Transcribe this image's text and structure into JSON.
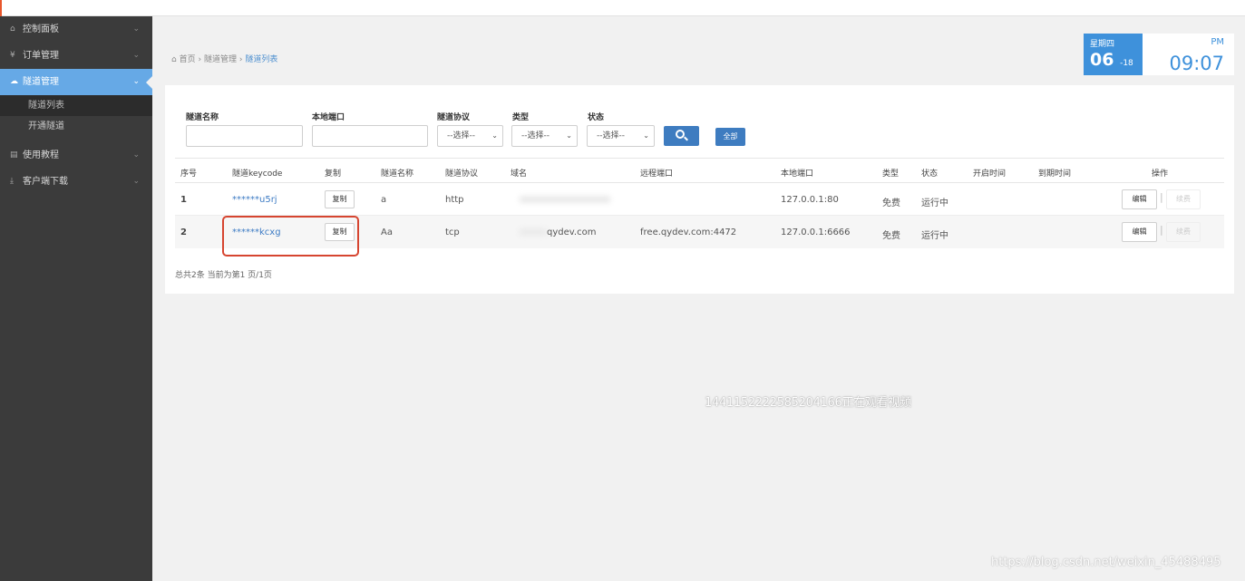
{
  "sidebar": {
    "items": [
      {
        "label": "控制面板",
        "icon": "home-icon"
      },
      {
        "label": "订单管理",
        "icon": "yen-icon"
      },
      {
        "label": "隧道管理",
        "icon": "cloud-icon"
      },
      {
        "label": "使用教程",
        "icon": "book-icon"
      },
      {
        "label": "客户端下载",
        "icon": "download-icon"
      }
    ],
    "submenu": [
      {
        "label": "隧道列表"
      },
      {
        "label": "开通隧道"
      }
    ]
  },
  "breadcrumb": {
    "home": "首页",
    "sep": "›",
    "level2": "隧道管理",
    "current": "隧道列表"
  },
  "clock": {
    "weekday": "星期四",
    "day": "06",
    "month": "-18",
    "ampm": "PM",
    "time": "09:07"
  },
  "filters": {
    "name_label": "隧道名称",
    "port_label": "本地端口",
    "protocol_label": "隧道协议",
    "type_label": "类型",
    "status_label": "状态",
    "select_placeholder": "--选择--",
    "all_label": "全部"
  },
  "table": {
    "headers": [
      "序号",
      "隧道keycode",
      "复制",
      "隧道名称",
      "隧道协议",
      "域名",
      "远程端口",
      "本地端口",
      "类型",
      "状态",
      "开启时间",
      "到期时间",
      "操作"
    ],
    "rows": [
      {
        "idx": "1",
        "keycode": "******u5rj",
        "copy": "复制",
        "name": "a",
        "protocol": "http",
        "domain": "",
        "remote_port": "",
        "local_port": "127.0.0.1:80",
        "type": "免费",
        "status": "运行中",
        "edit": "编辑",
        "renew": "续费"
      },
      {
        "idx": "2",
        "keycode": "******kcxg",
        "copy": "复制",
        "name": "Aa",
        "protocol": "tcp",
        "domain": "qydev.com",
        "remote_port": "free.qydev.com:4472",
        "local_port": "127.0.0.1:6666",
        "type": "免费",
        "status": "运行中",
        "edit": "编辑",
        "renew": "续费"
      }
    ],
    "summary": "总共2条 当前为第1 页/1页"
  },
  "watermark": {
    "center": "1441152222585204166正在观看视频",
    "corner": "https://blog.csdn.net/weixin_45488495"
  },
  "colors": {
    "accent": "#3e91db",
    "sidebar": "#3b3b3b",
    "active": "#66a9e6",
    "highlight": "#d64530"
  }
}
